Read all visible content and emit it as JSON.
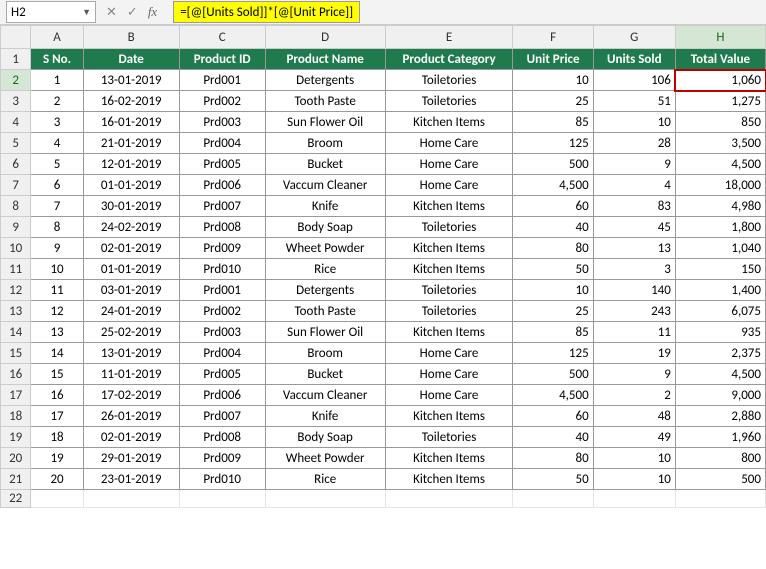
{
  "namebox": {
    "cell_ref": "H2"
  },
  "formula_bar": {
    "formula": "=[@[Units Sold]]*[@[Unit Price]]"
  },
  "columns": [
    "A",
    "B",
    "C",
    "D",
    "E",
    "F",
    "G",
    "H"
  ],
  "active_col": "H",
  "active_row": 2,
  "headers": {
    "sno": "S No.",
    "date": "Date",
    "pid": "Product ID",
    "pname": "Product Name",
    "pcat": "Product Category",
    "uprice": "Unit Price",
    "usold": "Units Sold",
    "tval": "Total Value"
  },
  "rows": [
    {
      "sno": "1",
      "date": "13-01-2019",
      "pid": "Prd001",
      "pname": "Detergents",
      "pcat": "Toiletories",
      "uprice": "10",
      "usold": "106",
      "tval": "1,060"
    },
    {
      "sno": "2",
      "date": "16-02-2019",
      "pid": "Prd002",
      "pname": "Tooth Paste",
      "pcat": "Toiletories",
      "uprice": "25",
      "usold": "51",
      "tval": "1,275"
    },
    {
      "sno": "3",
      "date": "16-01-2019",
      "pid": "Prd003",
      "pname": "Sun Flower Oil",
      "pcat": "Kitchen Items",
      "uprice": "85",
      "usold": "10",
      "tval": "850"
    },
    {
      "sno": "4",
      "date": "21-01-2019",
      "pid": "Prd004",
      "pname": "Broom",
      "pcat": "Home Care",
      "uprice": "125",
      "usold": "28",
      "tval": "3,500"
    },
    {
      "sno": "5",
      "date": "12-01-2019",
      "pid": "Prd005",
      "pname": "Bucket",
      "pcat": "Home Care",
      "uprice": "500",
      "usold": "9",
      "tval": "4,500"
    },
    {
      "sno": "6",
      "date": "01-01-2019",
      "pid": "Prd006",
      "pname": "Vaccum Cleaner",
      "pcat": "Home Care",
      "uprice": "4,500",
      "usold": "4",
      "tval": "18,000"
    },
    {
      "sno": "7",
      "date": "30-01-2019",
      "pid": "Prd007",
      "pname": "Knife",
      "pcat": "Kitchen Items",
      "uprice": "60",
      "usold": "83",
      "tval": "4,980"
    },
    {
      "sno": "8",
      "date": "24-02-2019",
      "pid": "Prd008",
      "pname": "Body Soap",
      "pcat": "Toiletories",
      "uprice": "40",
      "usold": "45",
      "tval": "1,800"
    },
    {
      "sno": "9",
      "date": "02-01-2019",
      "pid": "Prd009",
      "pname": "Wheet Powder",
      "pcat": "Kitchen Items",
      "uprice": "80",
      "usold": "13",
      "tval": "1,040"
    },
    {
      "sno": "10",
      "date": "01-01-2019",
      "pid": "Prd010",
      "pname": "Rice",
      "pcat": "Kitchen Items",
      "uprice": "50",
      "usold": "3",
      "tval": "150"
    },
    {
      "sno": "11",
      "date": "03-01-2019",
      "pid": "Prd001",
      "pname": "Detergents",
      "pcat": "Toiletories",
      "uprice": "10",
      "usold": "140",
      "tval": "1,400"
    },
    {
      "sno": "12",
      "date": "24-01-2019",
      "pid": "Prd002",
      "pname": "Tooth Paste",
      "pcat": "Toiletories",
      "uprice": "25",
      "usold": "243",
      "tval": "6,075"
    },
    {
      "sno": "13",
      "date": "25-02-2019",
      "pid": "Prd003",
      "pname": "Sun Flower Oil",
      "pcat": "Kitchen Items",
      "uprice": "85",
      "usold": "11",
      "tval": "935"
    },
    {
      "sno": "14",
      "date": "13-01-2019",
      "pid": "Prd004",
      "pname": "Broom",
      "pcat": "Home Care",
      "uprice": "125",
      "usold": "19",
      "tval": "2,375"
    },
    {
      "sno": "15",
      "date": "11-01-2019",
      "pid": "Prd005",
      "pname": "Bucket",
      "pcat": "Home Care",
      "uprice": "500",
      "usold": "9",
      "tval": "4,500"
    },
    {
      "sno": "16",
      "date": "17-02-2019",
      "pid": "Prd006",
      "pname": "Vaccum Cleaner",
      "pcat": "Home Care",
      "uprice": "4,500",
      "usold": "2",
      "tval": "9,000"
    },
    {
      "sno": "17",
      "date": "26-01-2019",
      "pid": "Prd007",
      "pname": "Knife",
      "pcat": "Kitchen Items",
      "uprice": "60",
      "usold": "48",
      "tval": "2,880"
    },
    {
      "sno": "18",
      "date": "02-01-2019",
      "pid": "Prd008",
      "pname": "Body Soap",
      "pcat": "Toiletories",
      "uprice": "40",
      "usold": "49",
      "tval": "1,960"
    },
    {
      "sno": "19",
      "date": "29-01-2019",
      "pid": "Prd009",
      "pname": "Wheet Powder",
      "pcat": "Kitchen Items",
      "uprice": "80",
      "usold": "10",
      "tval": "800"
    },
    {
      "sno": "20",
      "date": "23-01-2019",
      "pid": "Prd010",
      "pname": "Rice",
      "pcat": "Kitchen Items",
      "uprice": "50",
      "usold": "10",
      "tval": "500"
    }
  ],
  "chart_data": {
    "type": "table",
    "title": "",
    "columns": [
      "S No.",
      "Date",
      "Product ID",
      "Product Name",
      "Product Category",
      "Unit Price",
      "Units Sold",
      "Total Value"
    ],
    "rows": [
      [
        1,
        "13-01-2019",
        "Prd001",
        "Detergents",
        "Toiletories",
        10,
        106,
        1060
      ],
      [
        2,
        "16-02-2019",
        "Prd002",
        "Tooth Paste",
        "Toiletories",
        25,
        51,
        1275
      ],
      [
        3,
        "16-01-2019",
        "Prd003",
        "Sun Flower Oil",
        "Kitchen Items",
        85,
        10,
        850
      ],
      [
        4,
        "21-01-2019",
        "Prd004",
        "Broom",
        "Home Care",
        125,
        28,
        3500
      ],
      [
        5,
        "12-01-2019",
        "Prd005",
        "Bucket",
        "Home Care",
        500,
        9,
        4500
      ],
      [
        6,
        "01-01-2019",
        "Prd006",
        "Vaccum Cleaner",
        "Home Care",
        4500,
        4,
        18000
      ],
      [
        7,
        "30-01-2019",
        "Prd007",
        "Knife",
        "Kitchen Items",
        60,
        83,
        4980
      ],
      [
        8,
        "24-02-2019",
        "Prd008",
        "Body Soap",
        "Toiletories",
        40,
        45,
        1800
      ],
      [
        9,
        "02-01-2019",
        "Prd009",
        "Wheet Powder",
        "Kitchen Items",
        80,
        13,
        1040
      ],
      [
        10,
        "01-01-2019",
        "Prd010",
        "Rice",
        "Kitchen Items",
        50,
        3,
        150
      ],
      [
        11,
        "03-01-2019",
        "Prd001",
        "Detergents",
        "Toiletories",
        10,
        140,
        1400
      ],
      [
        12,
        "24-01-2019",
        "Prd002",
        "Tooth Paste",
        "Toiletories",
        25,
        243,
        6075
      ],
      [
        13,
        "25-02-2019",
        "Prd003",
        "Sun Flower Oil",
        "Kitchen Items",
        85,
        11,
        935
      ],
      [
        14,
        "13-01-2019",
        "Prd004",
        "Broom",
        "Home Care",
        125,
        19,
        2375
      ],
      [
        15,
        "11-01-2019",
        "Prd005",
        "Bucket",
        "Home Care",
        500,
        9,
        4500
      ],
      [
        16,
        "17-02-2019",
        "Prd006",
        "Vaccum Cleaner",
        "Home Care",
        4500,
        2,
        9000
      ],
      [
        17,
        "26-01-2019",
        "Prd007",
        "Knife",
        "Kitchen Items",
        60,
        48,
        2880
      ],
      [
        18,
        "02-01-2019",
        "Prd008",
        "Body Soap",
        "Toiletories",
        40,
        49,
        1960
      ],
      [
        19,
        "29-01-2019",
        "Prd009",
        "Wheet Powder",
        "Kitchen Items",
        80,
        10,
        800
      ],
      [
        20,
        "23-01-2019",
        "Prd010",
        "Rice",
        "Kitchen Items",
        50,
        10,
        500
      ]
    ]
  }
}
